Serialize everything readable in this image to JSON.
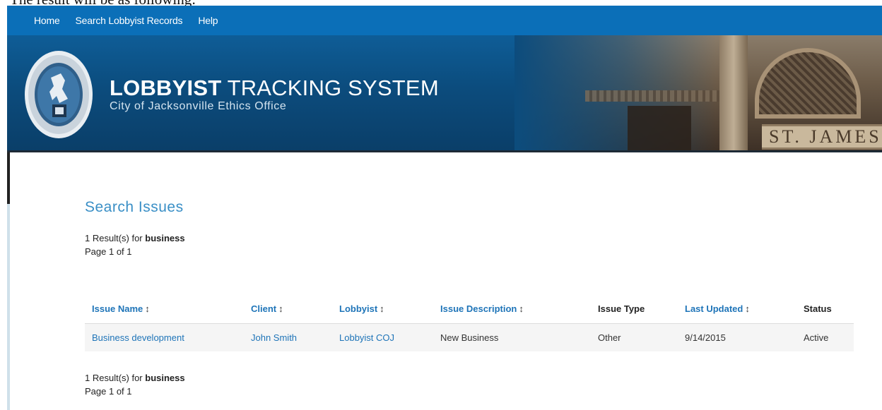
{
  "doc_caption": "The result will be as following:",
  "nav": {
    "items": [
      "Home",
      "Search Lobbyist Records",
      "Help"
    ]
  },
  "banner": {
    "title_bold": "LOBBYIST",
    "title_rest": " TRACKING SYSTEM",
    "subtitle": "City of Jacksonville Ethics Office",
    "sign_text": "ST. JAMES",
    "seal_icon": "city-seal-icon"
  },
  "page": {
    "title": "Search Issues",
    "result_count_text": "1 Result(s) for ",
    "query": "business",
    "page_text": "Page 1 of 1"
  },
  "table": {
    "columns": [
      {
        "label": "Issue Name",
        "sortable": true
      },
      {
        "label": "Client",
        "sortable": true
      },
      {
        "label": "Lobbyist",
        "sortable": true
      },
      {
        "label": "Issue Description",
        "sortable": true
      },
      {
        "label": "Issue Type",
        "sortable": false
      },
      {
        "label": "Last Updated",
        "sortable": true
      },
      {
        "label": "Status",
        "sortable": false
      }
    ],
    "sort_glyph": "↕",
    "rows": [
      {
        "issue_name": "Business development",
        "client": "John Smith",
        "lobbyist": "Lobbyist COJ",
        "issue_description": "New Business",
        "issue_type": "Other",
        "last_updated": "9/14/2015",
        "status": "Active"
      }
    ]
  },
  "colors": {
    "nav_bg": "#0b6fb8",
    "link": "#1e74b8",
    "page_title": "#3a8fc6"
  }
}
